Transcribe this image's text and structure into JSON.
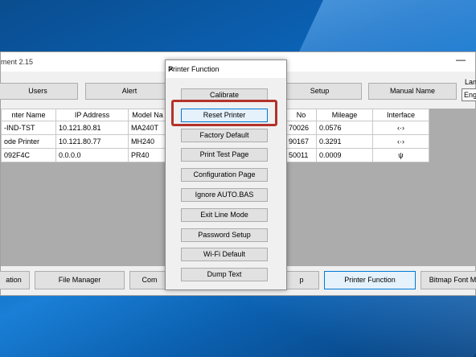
{
  "app": {
    "title": "ment 2.15",
    "minimize_glyph": "—",
    "toolbar": {
      "users": "Users",
      "alert": "Alert",
      "setup": "Setup",
      "manual_name": "Manual Name"
    },
    "language_label": "Lan",
    "language_value": "Eng",
    "table": {
      "headers": [
        "nter Name",
        "IP Address",
        "Model Na",
        "No",
        "Mileage",
        "Interface"
      ],
      "rows": [
        [
          "-IND-TST",
          "10.121.80.81",
          "MA240T",
          "70026",
          "0.0576",
          "‹·›"
        ],
        [
          "ode Printer",
          "10.121.80.77",
          "MH240",
          "90167",
          "0.3291",
          "‹·›"
        ],
        [
          "092F4C",
          "0.0.0.0",
          "PR40",
          "50011",
          "0.0009",
          "ψ"
        ]
      ]
    },
    "bottom": {
      "ation": "ation",
      "file_manager": "File Manager",
      "com": "Com",
      "p": "p",
      "printer_function": "Printer Function",
      "bitmap_font": "Bitmap Font M"
    }
  },
  "dialog": {
    "title": "Printer Function",
    "close_glyph": "✕",
    "buttons": [
      "Calibrate",
      "Reset Printer",
      "Factory Default",
      "Print Test Page",
      "Configuration Page",
      "Ignore AUTO.BAS",
      "Exit Line Mode",
      "Password Setup",
      "Wi-Fi Default",
      "Dump Text"
    ]
  },
  "colors": {
    "highlight": "#b4322a",
    "focus": "#0078d7"
  }
}
